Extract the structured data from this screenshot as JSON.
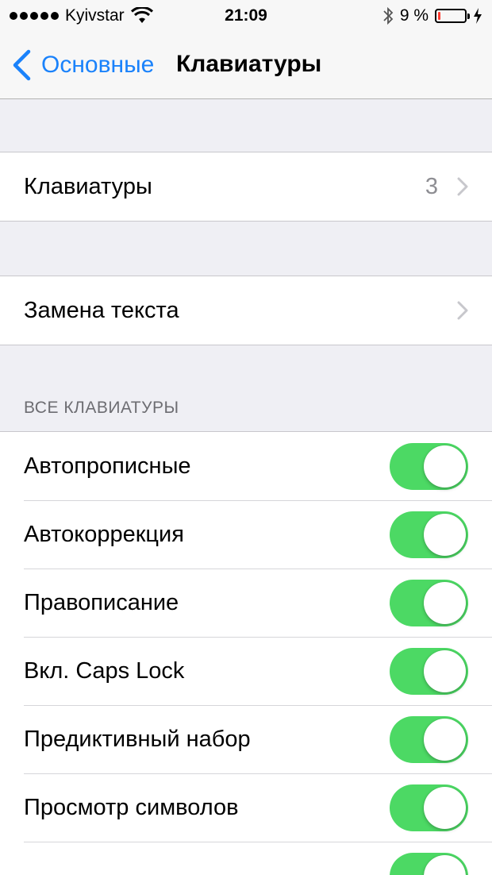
{
  "status_bar": {
    "carrier": "Kyivstar",
    "time": "21:09",
    "battery_percent": "9 %",
    "battery_level": 0.09,
    "battery_color": "#ff3b30"
  },
  "nav": {
    "back_label": "Основные",
    "title": "Клавиатуры",
    "accent_color": "#1a82fb"
  },
  "rows": {
    "keyboards": {
      "label": "Клавиатуры",
      "detail": "3"
    },
    "text_replacement": {
      "label": "Замена текста"
    }
  },
  "section_all_keyboards": {
    "header": "ВСЕ КЛАВИАТУРЫ",
    "toggles": [
      {
        "label": "Автопрописные",
        "on": true
      },
      {
        "label": "Автокоррекция",
        "on": true
      },
      {
        "label": "Правописание",
        "on": true
      },
      {
        "label": "Вкл. Caps Lock",
        "on": true
      },
      {
        "label": "Предиктивный набор",
        "on": true
      },
      {
        "label": "Просмотр символов",
        "on": true
      },
      {
        "label": "",
        "on": true
      }
    ],
    "switch_on_color": "#4cd964"
  }
}
